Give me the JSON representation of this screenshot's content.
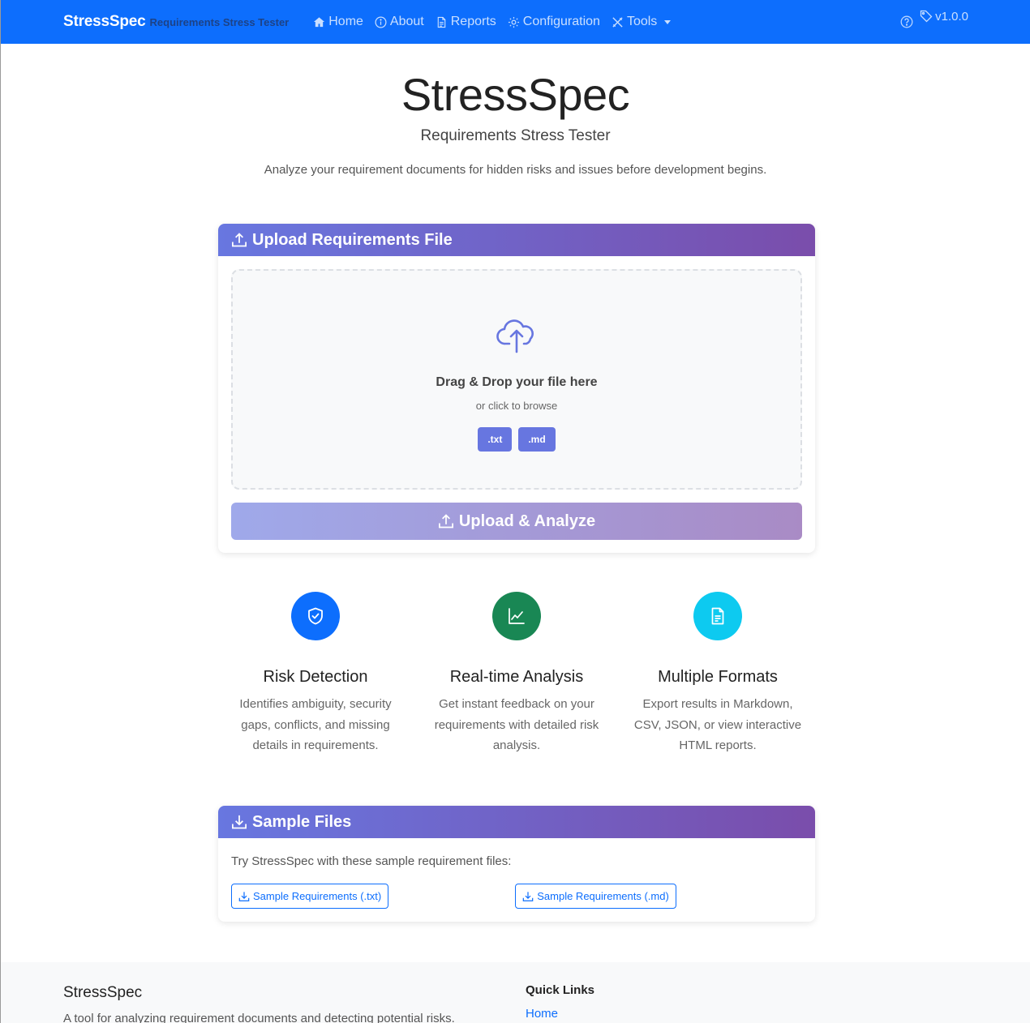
{
  "navbar": {
    "brand": "StressSpec",
    "brand_sub": "Requirements Stress Tester",
    "items": [
      {
        "label": "Home",
        "icon": "house-icon"
      },
      {
        "label": "About",
        "icon": "info-circle-icon"
      },
      {
        "label": "Reports",
        "icon": "file-text-icon"
      },
      {
        "label": "Configuration",
        "icon": "gear-icon"
      },
      {
        "label": "Tools",
        "icon": "tools-icon"
      }
    ],
    "version": "v1.0.0"
  },
  "hero": {
    "title": "StressSpec",
    "subtitle": "Requirements Stress Tester",
    "description": "Analyze your requirement documents for hidden risks and issues before development begins."
  },
  "upload": {
    "header": "Upload Requirements File",
    "drop_title": "Drag & Drop your file here",
    "drop_sub": "or click to browse",
    "formats": [
      ".txt",
      ".md"
    ],
    "button": "Upload & Analyze"
  },
  "features": [
    {
      "title": "Risk Detection",
      "desc": "Identifies ambiguity, security gaps, conflicts, and missing details in requirements.",
      "color": "#0d6efd",
      "icon": "shield-check-icon"
    },
    {
      "title": "Real-time Analysis",
      "desc": "Get instant feedback on your requirements with detailed risk analysis.",
      "color": "#198754",
      "icon": "graph-up-icon"
    },
    {
      "title": "Multiple Formats",
      "desc": "Export results in Markdown, CSV, JSON, or view interactive HTML reports.",
      "color": "#0dcaf0",
      "icon": "file-text-icon"
    }
  ],
  "samples": {
    "header": "Sample Files",
    "text": "Try StressSpec with these sample requirement files:",
    "links": [
      "Sample Requirements (.txt)",
      "Sample Requirements (.md)"
    ]
  },
  "footer": {
    "title": "StressSpec",
    "desc": "A tool for analyzing requirement documents and detecting potential risks.",
    "quick_links_title": "Quick Links",
    "quick_links": [
      "Home"
    ]
  }
}
